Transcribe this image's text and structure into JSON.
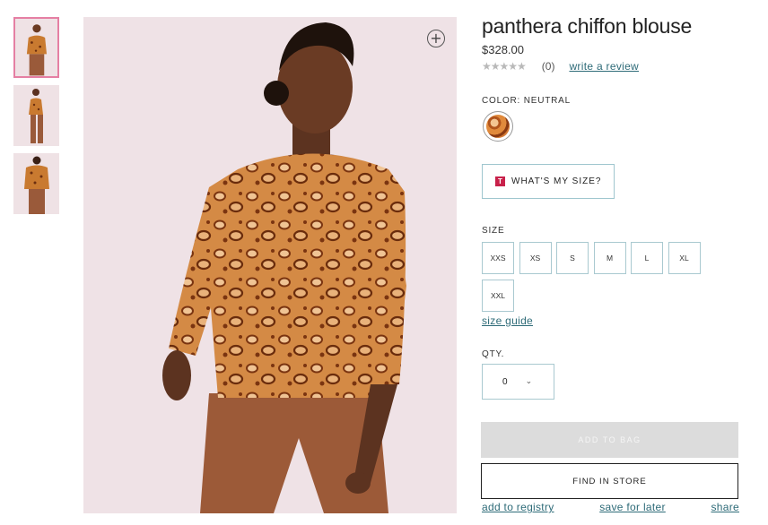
{
  "product": {
    "title": "panthera chiffon blouse",
    "price": "$328.00",
    "rating_stars": "★★★★★",
    "review_count": "(0)",
    "write_review": "write a review"
  },
  "color": {
    "label": "COLOR: NEUTRAL",
    "swatch_name": "neutral"
  },
  "fit_tool": {
    "badge": "T",
    "label": "WHAT'S MY SIZE?"
  },
  "sizes": {
    "label": "SIZE",
    "options": [
      "XXS",
      "XS",
      "S",
      "M",
      "L",
      "XL",
      "XXL"
    ],
    "guide": "size guide"
  },
  "quantity": {
    "label": "QTY.",
    "value": "0",
    "chevron": "⌄"
  },
  "actions": {
    "add_to_bag": "ADD TO BAG",
    "find_in_store": "FIND IN STORE",
    "add_to_registry": "add to registry",
    "save_for_later": "save for later",
    "share": "share"
  },
  "gallery": {
    "zoom_icon": "+",
    "thumbnails": [
      "front",
      "side",
      "back"
    ]
  },
  "colors": {
    "link": "#2e6b78",
    "active_thumb_border": "#e57fa3",
    "background_pink": "#efe2e6"
  }
}
